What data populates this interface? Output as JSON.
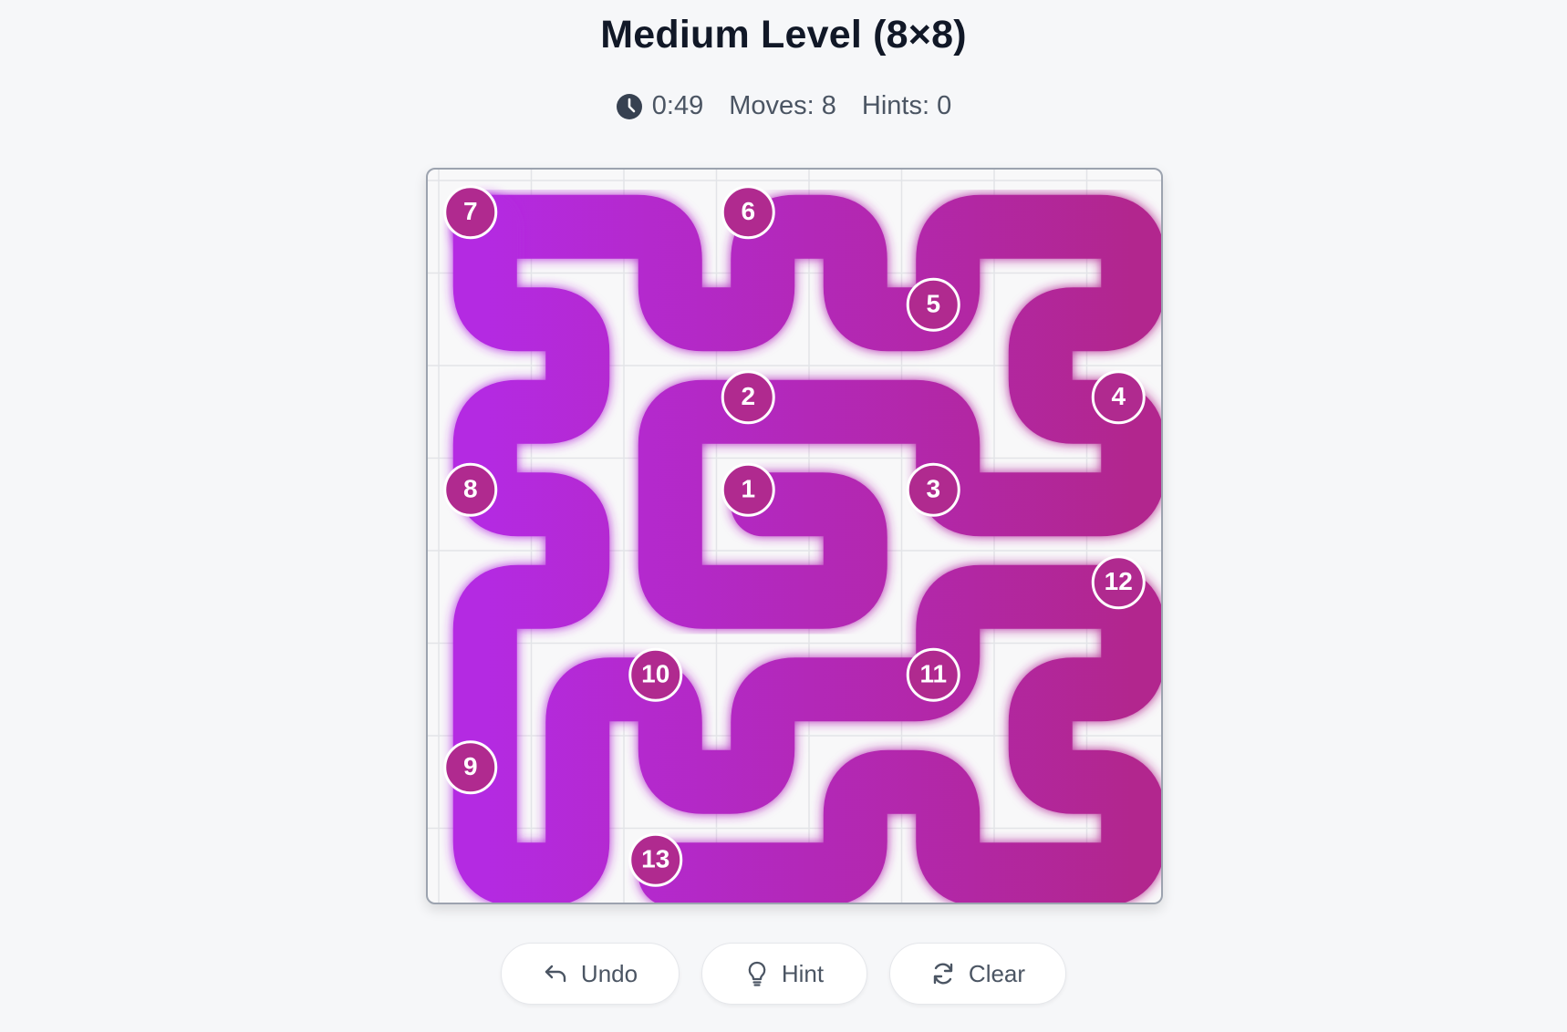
{
  "game": {
    "title": "Medium Level (8×8)",
    "grid_size": 8
  },
  "stats": {
    "timer": "0:49",
    "timer_icon": "clock-icon",
    "moves": "Moves: 8",
    "hints": "Hints: 0"
  },
  "colors": {
    "path_start": "#b429e2",
    "path_end": "#b2288e",
    "numbered_dot": "#b02a8f",
    "dot_border": "#ffffff",
    "grid_line": "#e3e4e8"
  },
  "path": [
    [
      0,
      0
    ],
    [
      1,
      0
    ],
    [
      2,
      0
    ],
    [
      2,
      1
    ],
    [
      3,
      1
    ],
    [
      3,
      0
    ],
    [
      4,
      0
    ],
    [
      4,
      1
    ],
    [
      5,
      1
    ],
    [
      5,
      0
    ],
    [
      6,
      0
    ],
    [
      7,
      0
    ],
    [
      7,
      1
    ],
    [
      6,
      1
    ],
    [
      6,
      2
    ],
    [
      7,
      2
    ],
    [
      7,
      3
    ],
    [
      6,
      3
    ],
    [
      5,
      3
    ],
    [
      5,
      2
    ],
    [
      4,
      2
    ],
    [
      3,
      2
    ],
    [
      2,
      2
    ],
    [
      2,
      3
    ],
    [
      2,
      4
    ],
    [
      3,
      4
    ],
    [
      4,
      4
    ],
    [
      4,
      3
    ],
    [
      3,
      3
    ]
  ],
  "path2": [
    [
      0,
      0
    ],
    [
      0,
      1
    ],
    [
      1,
      1
    ],
    [
      1,
      2
    ],
    [
      0,
      2
    ],
    [
      0,
      3
    ],
    [
      1,
      3
    ],
    [
      1,
      4
    ],
    [
      0,
      4
    ],
    [
      0,
      5
    ],
    [
      0,
      6
    ],
    [
      0,
      7
    ],
    [
      1,
      7
    ],
    [
      1,
      6
    ],
    [
      1,
      5
    ],
    [
      2,
      5
    ],
    [
      2,
      6
    ],
    [
      3,
      6
    ],
    [
      3,
      5
    ],
    [
      4,
      5
    ],
    [
      5,
      5
    ],
    [
      5,
      4
    ],
    [
      6,
      4
    ],
    [
      7,
      4
    ],
    [
      7,
      5
    ],
    [
      6,
      5
    ],
    [
      6,
      6
    ],
    [
      7,
      6
    ],
    [
      7,
      7
    ],
    [
      6,
      7
    ],
    [
      5,
      7
    ],
    [
      5,
      6
    ],
    [
      4,
      6
    ],
    [
      4,
      7
    ],
    [
      3,
      7
    ],
    [
      2,
      7
    ]
  ],
  "numbers": [
    {
      "label": "1",
      "col": 3,
      "row": 3
    },
    {
      "label": "2",
      "col": 3,
      "row": 2
    },
    {
      "label": "3",
      "col": 5,
      "row": 3
    },
    {
      "label": "4",
      "col": 7,
      "row": 2
    },
    {
      "label": "5",
      "col": 5,
      "row": 1
    },
    {
      "label": "6",
      "col": 3,
      "row": 0
    },
    {
      "label": "7",
      "col": 0,
      "row": 0
    },
    {
      "label": "8",
      "col": 0,
      "row": 3
    },
    {
      "label": "9",
      "col": 0,
      "row": 6
    },
    {
      "label": "10",
      "col": 2,
      "row": 5
    },
    {
      "label": "11",
      "col": 5,
      "row": 5
    },
    {
      "label": "12",
      "col": 7,
      "row": 4
    },
    {
      "label": "13",
      "col": 2,
      "row": 7
    }
  ],
  "buttons": {
    "undo": {
      "label": "Undo",
      "icon": "undo-icon"
    },
    "hint": {
      "label": "Hint",
      "icon": "lightbulb-icon"
    },
    "clear": {
      "label": "Clear",
      "icon": "refresh-icon"
    }
  }
}
